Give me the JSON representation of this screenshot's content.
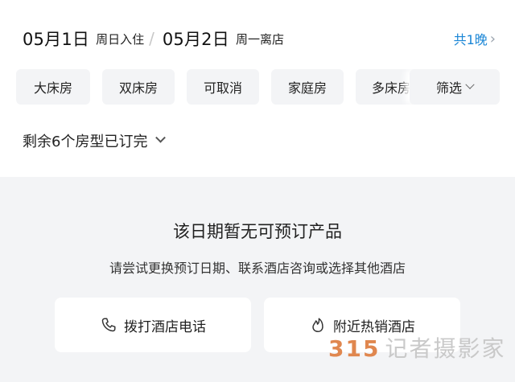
{
  "dates": {
    "checkin_date": "05月1日",
    "checkin_label": "周日入住",
    "separator": "/",
    "checkout_date": "05月2日",
    "checkout_label": "周一离店",
    "nights": "共1晚"
  },
  "filters": {
    "chips": [
      "大床房",
      "双床房",
      "可取消",
      "家庭房",
      "多床房"
    ],
    "filter_button": "筛选"
  },
  "soldout_text": "剩余6个房型已订完",
  "empty_state": {
    "title": "该日期暂无可预订产品",
    "subtitle": "请尝试更换预订日期、联系酒店咨询或选择其他酒店"
  },
  "actions": {
    "call_hotel": "拨打酒店电话",
    "nearby_hotels": "附近热销酒店"
  },
  "watermark": {
    "number": "315",
    "text": "记者摄影家"
  },
  "colors": {
    "accent": "#1a86d6",
    "watermark_number": "#e0874f",
    "chip_bg": "#f3f4f6"
  }
}
